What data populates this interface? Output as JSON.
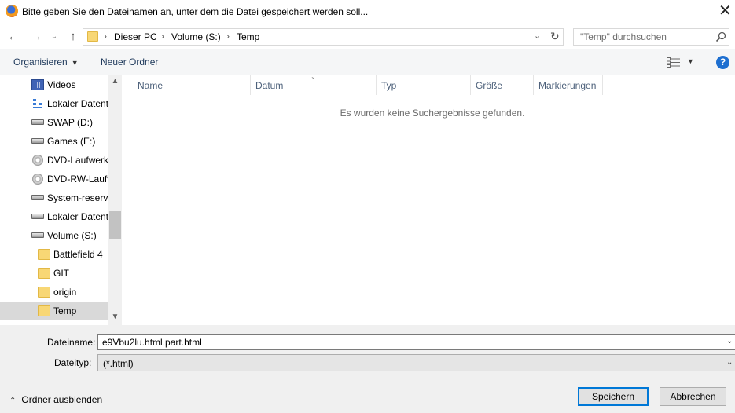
{
  "window": {
    "title": "Bitte geben Sie den Dateinamen an, unter dem die Datei gespeichert werden soll...",
    "close_glyph": "✕"
  },
  "navigation": {
    "back_glyph": "←",
    "forward_glyph": "→",
    "recent_glyph": "⌄",
    "up_glyph": "↑"
  },
  "address": {
    "separator": "›",
    "breadcrumbs": [
      "Dieser PC",
      "Volume (S:)",
      "Temp"
    ],
    "dropdown_glyph": "⌄",
    "refresh_glyph": "↻"
  },
  "search": {
    "placeholder": "\"Temp\" durchsuchen"
  },
  "toolbar": {
    "organize_label": "Organisieren",
    "organize_caret": "▼",
    "new_folder_label": "Neuer Ordner",
    "view_caret": "▼",
    "help_label": "?"
  },
  "sidebar": {
    "items": [
      {
        "label": "Videos",
        "icon": "video-folder-icon"
      },
      {
        "label": "Lokaler Datentr",
        "icon": "network-icon"
      },
      {
        "label": "SWAP (D:)",
        "icon": "drive-icon"
      },
      {
        "label": "Games (E:)",
        "icon": "drive-icon"
      },
      {
        "label": "DVD-Laufwerk",
        "icon": "dvd-drive-icon"
      },
      {
        "label": "DVD-RW-Laufv",
        "icon": "dvd-drive-icon"
      },
      {
        "label": "System-reservi",
        "icon": "drive-icon"
      },
      {
        "label": "Lokaler Datentr",
        "icon": "drive-icon"
      },
      {
        "label": "Volume (S:)",
        "icon": "drive-icon"
      },
      {
        "label": "Battlefield 4",
        "icon": "folder-icon"
      },
      {
        "label": "GIT",
        "icon": "folder-icon"
      },
      {
        "label": "origin",
        "icon": "folder-icon"
      },
      {
        "label": "Temp",
        "icon": "folder-icon",
        "selected": true
      }
    ],
    "scroll_up_glyph": "▲",
    "scroll_down_glyph": "▼",
    "scroll_position": 0.63
  },
  "file_list": {
    "columns": [
      "Name",
      "Datum",
      "Typ",
      "Größe",
      "Markierungen"
    ],
    "sort_glyph": "⌄",
    "empty_message": "Es wurden keine Suchergebnisse gefunden."
  },
  "form": {
    "filename_label": "Dateiname:",
    "filename_value": "e9Vbu2lu.html.part.html",
    "filetype_label": "Dateityp:",
    "filetype_value": "(*.html)",
    "dropdown_glyph": "⌄"
  },
  "footer": {
    "hide_folders_label": "Ordner ausblenden",
    "hide_folders_glyph": "⌃",
    "save_label": "Speichern",
    "cancel_label": "Abbrechen"
  }
}
